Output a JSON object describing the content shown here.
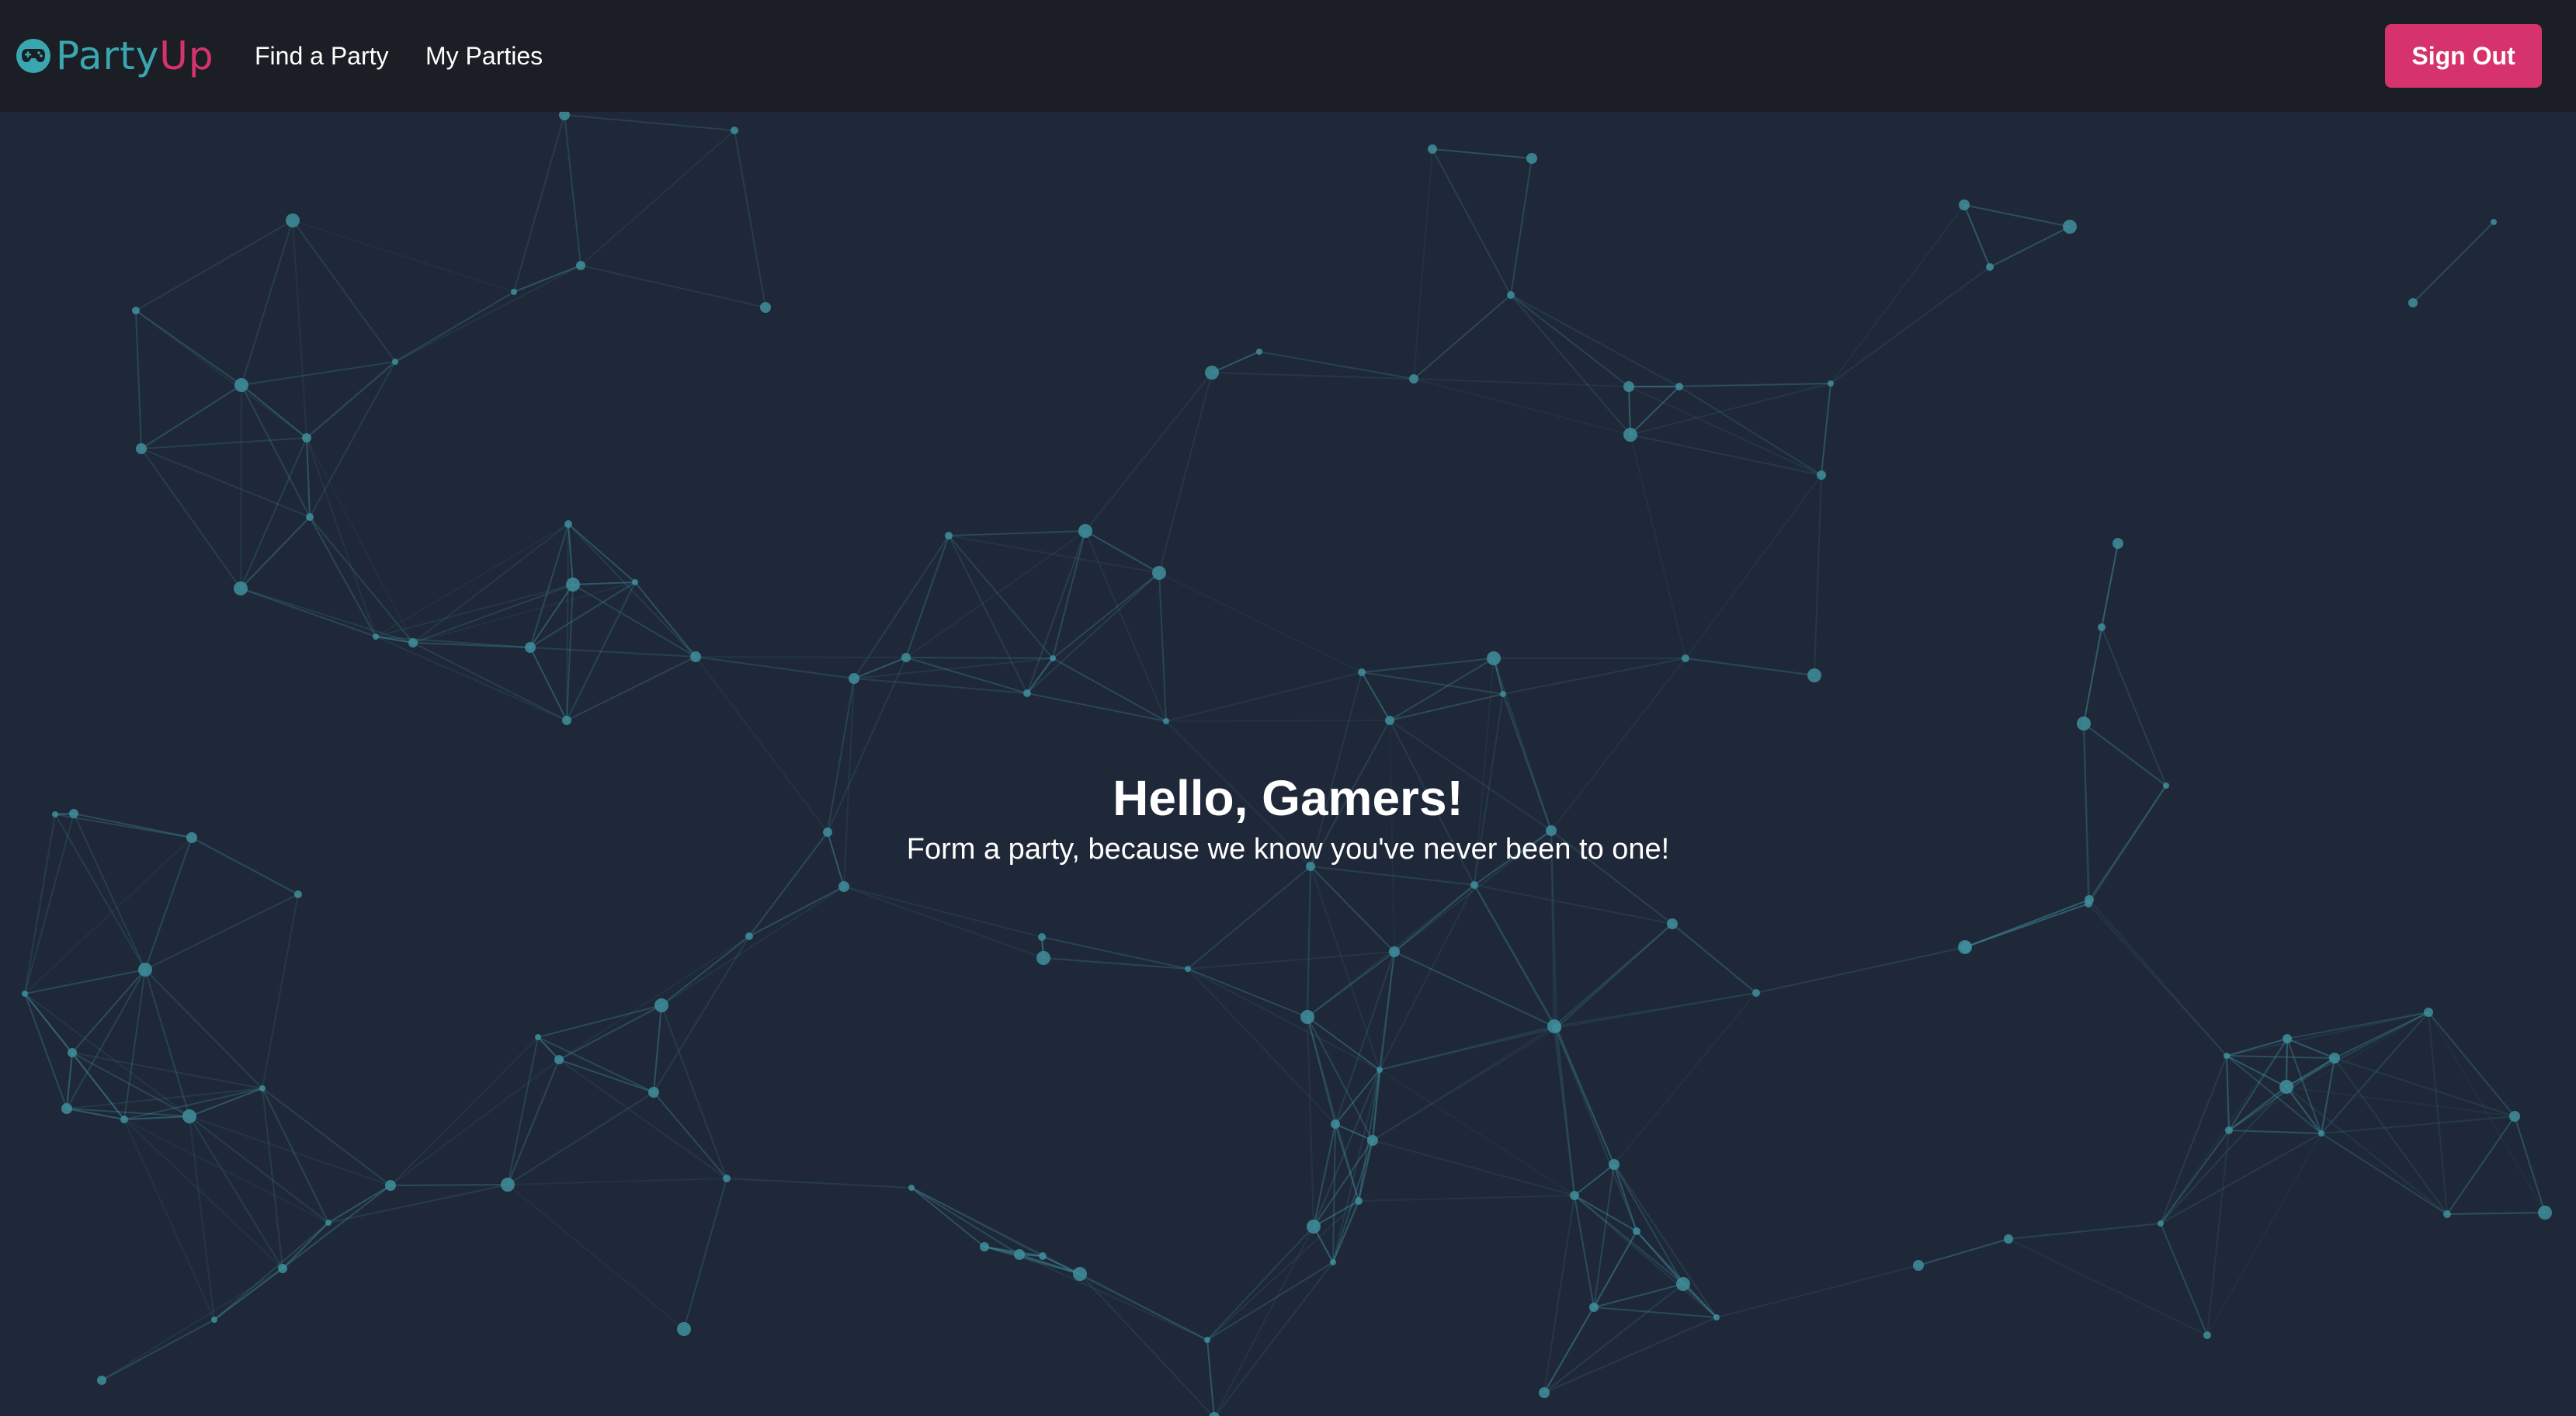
{
  "brand": {
    "name_part1": "Party",
    "name_part2": "Up",
    "icon": "gamepad-icon",
    "color_party": "#3aa6b0",
    "color_up": "#d6336c"
  },
  "nav": {
    "links": [
      {
        "label": "Find a Party"
      },
      {
        "label": "My Parties"
      }
    ],
    "signout_label": "Sign Out"
  },
  "hero": {
    "title": "Hello, Gamers!",
    "subtitle": "Form a party, because we know you've never been to one!"
  },
  "colors": {
    "navbar_bg": "#1b1e24",
    "page_bg": "#1f2838",
    "accent_pink": "#d6336c",
    "network_teal": "#3f8e9b"
  }
}
